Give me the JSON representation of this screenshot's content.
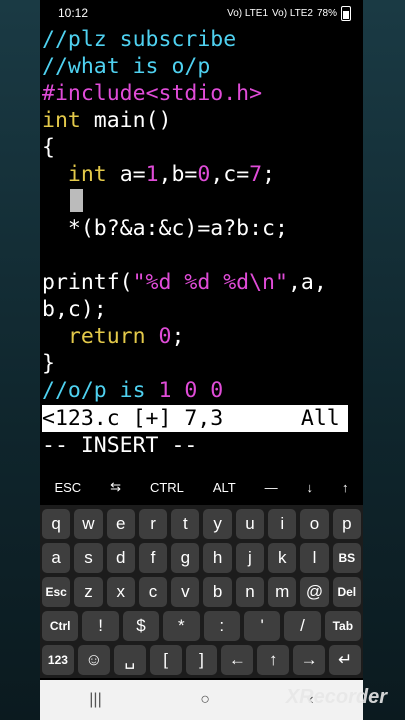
{
  "status_bar": {
    "time": "10:12",
    "battery": "78%",
    "network_left": "Vo) LTE1",
    "network_right": "Vo) LTE2"
  },
  "editor": {
    "lines": [
      "//plz subscribe",
      "//what is o/p",
      "#include",
      "<stdio.h>",
      "int",
      "main()",
      "{",
      "int",
      "a=",
      "1",
      ",b=",
      "0",
      ",c=",
      "7",
      ";",
      "*(b?&a:&c)=a?b:c;",
      "printf(",
      "\"%d %d %d\\n\"",
      ",a,",
      "b,c);",
      "return",
      "0",
      ";",
      "}",
      "//o/p is",
      "1 0 0"
    ]
  },
  "statusline": {
    "file": "<123.c [+]",
    "pos": "7,3",
    "scroll": "All"
  },
  "mode_line": "-- INSERT --",
  "extra_keys": [
    "ESC",
    "⇆",
    "CTRL",
    "ALT",
    "—",
    "↓",
    "↑"
  ],
  "keyboard": {
    "row1": [
      "q",
      "w",
      "e",
      "r",
      "t",
      "y",
      "u",
      "i",
      "o",
      "p"
    ],
    "row2": [
      "a",
      "s",
      "d",
      "f",
      "g",
      "h",
      "j",
      "k",
      "l",
      "BS"
    ],
    "row3": [
      "Esc",
      "z",
      "x",
      "c",
      "v",
      "b",
      "n",
      "m",
      "@",
      "Del"
    ],
    "row4": [
      "Ctrl",
      "!",
      "$",
      "*",
      ":",
      "'",
      "/",
      "Tab"
    ],
    "row5": [
      "123",
      "☺",
      "␣",
      "[",
      "]",
      "←",
      "↑",
      "→",
      "↵"
    ]
  },
  "nav": {
    "recent": "|||",
    "home": "○",
    "back": "‹"
  },
  "watermark": "XRecorder"
}
